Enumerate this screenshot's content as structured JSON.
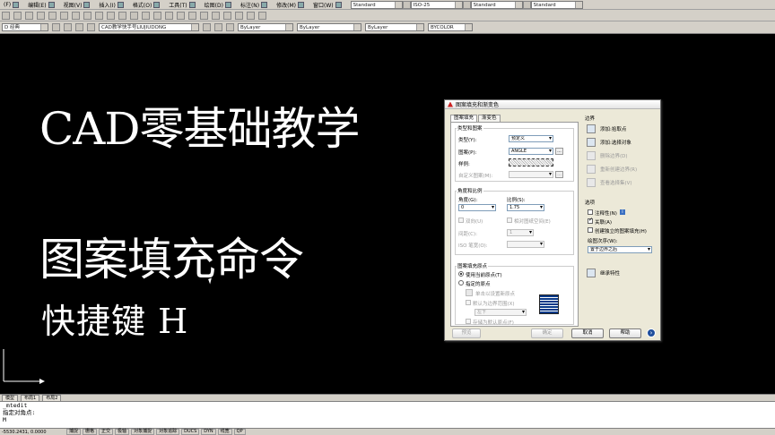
{
  "menubar": {
    "items": [
      {
        "label": "(F)"
      },
      {
        "label": "编辑(E)"
      },
      {
        "label": "视图(V)"
      },
      {
        "label": "插入(I)"
      },
      {
        "label": "格式(O)"
      },
      {
        "label": "工具(T)"
      },
      {
        "label": "绘图(D)"
      },
      {
        "label": "标注(N)"
      },
      {
        "label": "修改(M)"
      },
      {
        "label": "窗口(W)"
      }
    ]
  },
  "toolbar_top": {
    "text_style": "Standard",
    "dim_style": "ISO-25",
    "table_style": "Standard",
    "multileader_style": "Standard"
  },
  "toolbar_second": {
    "workspace": "D 经典",
    "layer": "CAD教学快手号LIUJIUDONG",
    "color": "ByLayer",
    "linetype": "ByLayer",
    "lineweight": "ByLayer",
    "plot_style": "BYCOLOR"
  },
  "canvas": {
    "title_line1": "CAD零基础教学",
    "title_line2": "图案填充命令",
    "title_line3": "快捷键  H"
  },
  "layout_tabs": [
    "模型",
    "布局1",
    "布局2"
  ],
  "command_line": {
    "history": "_mtedit",
    "prompt": "指定对角点:",
    "input": "M"
  },
  "status_bar": {
    "coords": "-5530.2431, 0.0000",
    "buttons": [
      "捕捉",
      "栅格",
      "正交",
      "极轴",
      "对象捕捉",
      "对象追踪",
      "DUCS",
      "DYN",
      "线宽",
      "QP"
    ]
  },
  "dialog": {
    "title": "图案填充和渐变色",
    "tabs": [
      "图案填充",
      "渐变色"
    ],
    "type_pattern": {
      "group_label": "类型和图案",
      "type_label": "类型(Y):",
      "type_value": "预定义",
      "pattern_label": "图案(P):",
      "pattern_value": "ANGLE",
      "pattern_browse": "...",
      "swatch_label": "样例:",
      "custom_label": "自定义图案(M):",
      "custom_browse": "..."
    },
    "angle_scale": {
      "group_label": "角度和比例",
      "angle_label": "角度(G):",
      "angle_value": "0",
      "scale_label": "比例(S):",
      "scale_value": "1.75",
      "double_label": "双向(U)",
      "relative_label": "相对图纸空间(E)",
      "spacing_label": "间距(C):",
      "spacing_value": "1",
      "iso_label": "ISO 笔宽(O):"
    },
    "origin": {
      "group_label": "图案填充原点",
      "use_current": "使用当前原点(T)",
      "specified": "指定的原点",
      "click_set": "单击以设置新原点",
      "default_extents": "默认为边界范围(X)",
      "extents_value": "左下",
      "store_default": "存储为默认原点(F)"
    },
    "boundaries": {
      "label": "边界",
      "add_pick": "添加:拾取点",
      "add_select": "添加:选择对象",
      "remove": "删除边界(D)",
      "recreate": "重新创建边界(R)",
      "view_selections": "查看选择集(V)"
    },
    "options": {
      "label": "选项",
      "annotative": "注释性(N)",
      "associative": "关联(A)",
      "separate": "创建独立的图案填充(H)",
      "draw_order_label": "绘图次序(W):",
      "draw_order_value": "置于边界之后",
      "inherit": "继承特性"
    },
    "footer": {
      "preview": "预览",
      "ok": "确定",
      "cancel": "取消",
      "help": "帮助",
      "more": "›"
    }
  }
}
